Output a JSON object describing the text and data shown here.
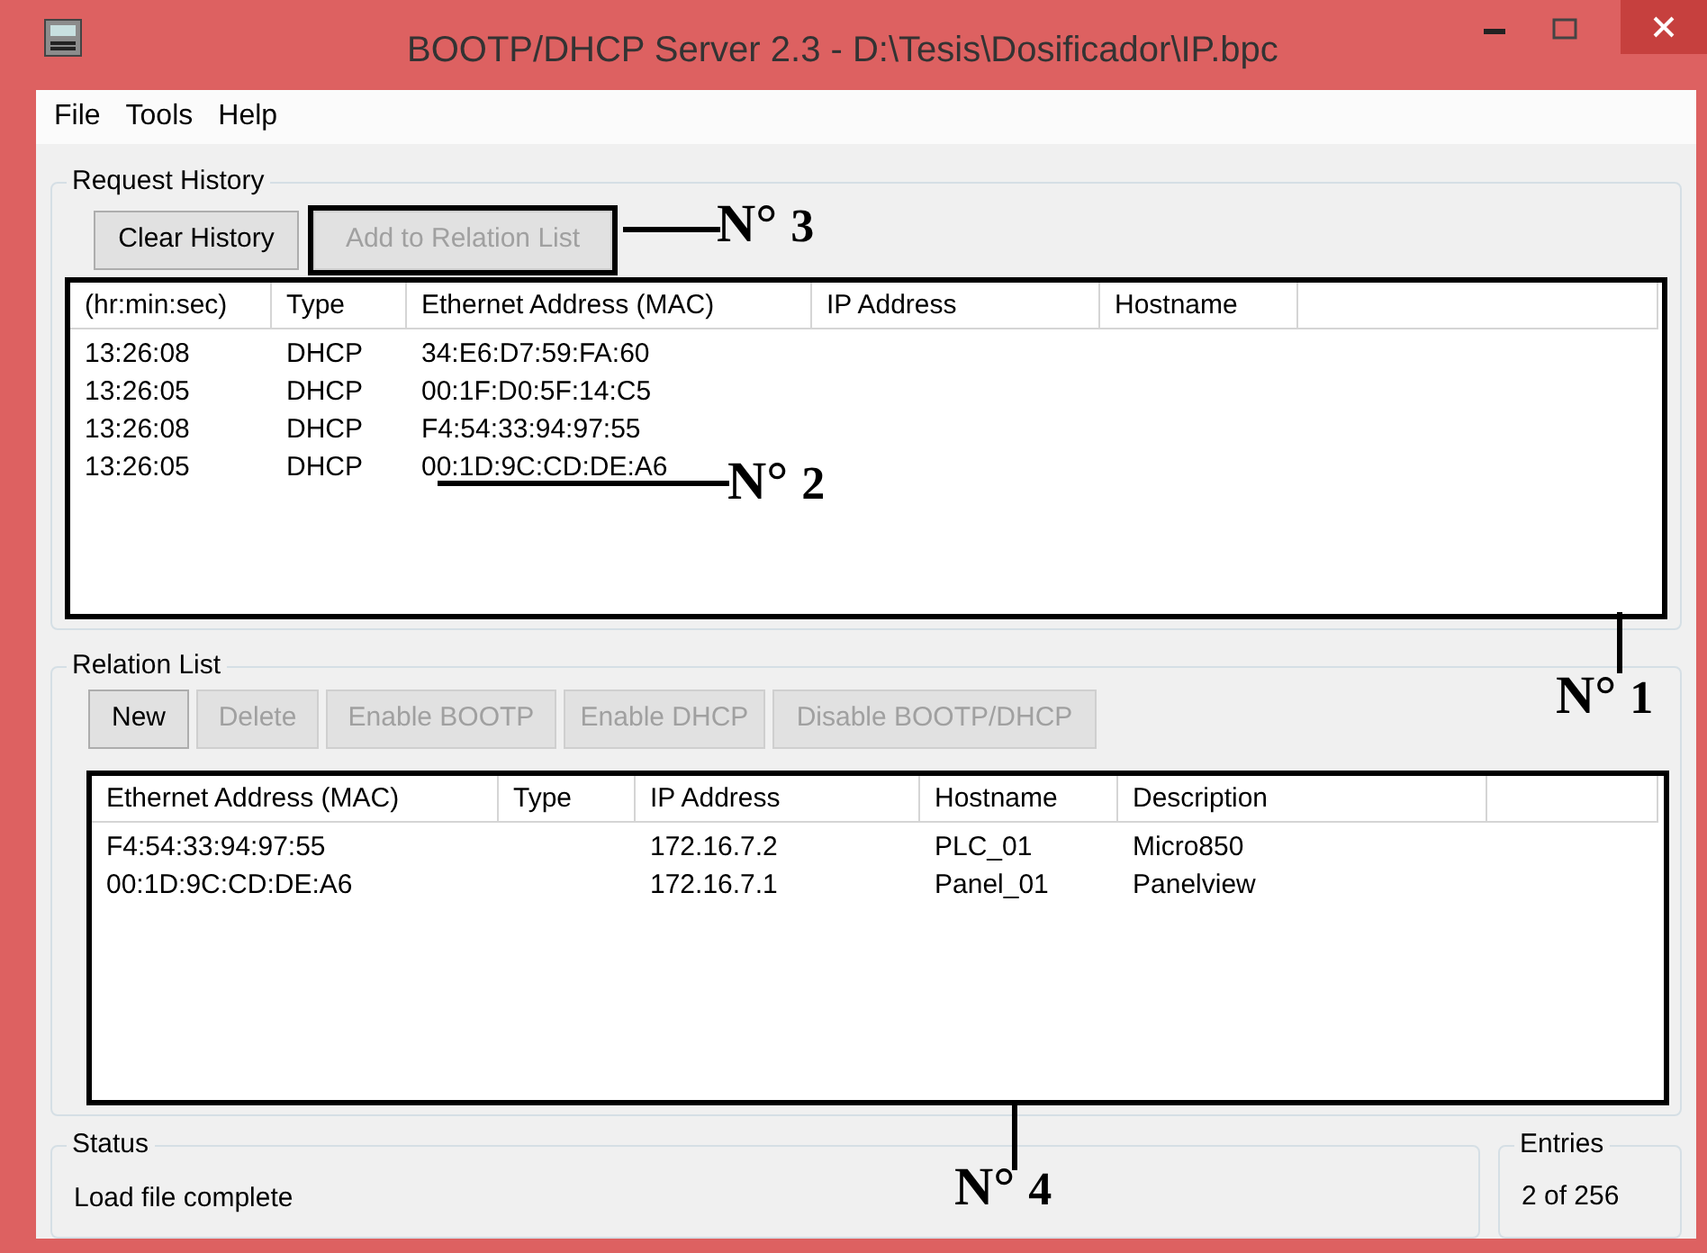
{
  "window": {
    "title": "BOOTP/DHCP Server 2.3 - D:\\Tesis\\Dosificador\\IP.bpc"
  },
  "menu": [
    "File",
    "Tools",
    "Help"
  ],
  "request_history": {
    "title": "Request History",
    "buttons": [
      {
        "label": "Clear History",
        "disabled": false,
        "highlighted": false
      },
      {
        "label": "Add to Relation List",
        "disabled": true,
        "highlighted": true
      }
    ],
    "highlighted": true,
    "columns": [
      "(hr:min:sec)",
      "Type",
      "Ethernet Address (MAC)",
      "IP Address",
      "Hostname"
    ],
    "rows": [
      [
        "13:26:08",
        "DHCP",
        "34:E6:D7:59:FA:60"
      ],
      [
        "13:26:05",
        "DHCP",
        "00:1F:D0:5F:14:C5"
      ],
      [
        "13:26:08",
        "DHCP",
        "F4:54:33:94:97:55"
      ],
      [
        "13:26:05",
        "DHCP",
        "00:1D:9C:CD:DE:A6"
      ]
    ]
  },
  "relation_list": {
    "title": "Relation List",
    "buttons": [
      {
        "label": "New",
        "disabled": false
      },
      {
        "label": "Delete",
        "disabled": true
      },
      {
        "label": "Enable BOOTP",
        "disabled": true
      },
      {
        "label": "Enable DHCP",
        "disabled": true
      },
      {
        "label": "Disable BOOTP/DHCP",
        "disabled": true
      }
    ],
    "highlighted": true,
    "columns": [
      "Ethernet Address (MAC)",
      "Type",
      "IP Address",
      "Hostname",
      "Description"
    ],
    "rows": [
      [
        "F4:54:33:94:97:55",
        "",
        "172.16.7.2",
        "PLC_01",
        "Micro850"
      ],
      [
        "00:1D:9C:CD:DE:A6",
        "",
        "172.16.7.1",
        "Panel_01",
        "Panelview"
      ]
    ]
  },
  "status": {
    "title": "Status",
    "text": "Load file complete"
  },
  "entries": {
    "title": "Entries",
    "text": "2 of 256"
  },
  "annotations": [
    {
      "label": "N°",
      "number": "3"
    },
    {
      "label": "N°",
      "number": "2"
    },
    {
      "label": "N°",
      "number": "1"
    },
    {
      "label": "N°",
      "number": "4"
    }
  ]
}
